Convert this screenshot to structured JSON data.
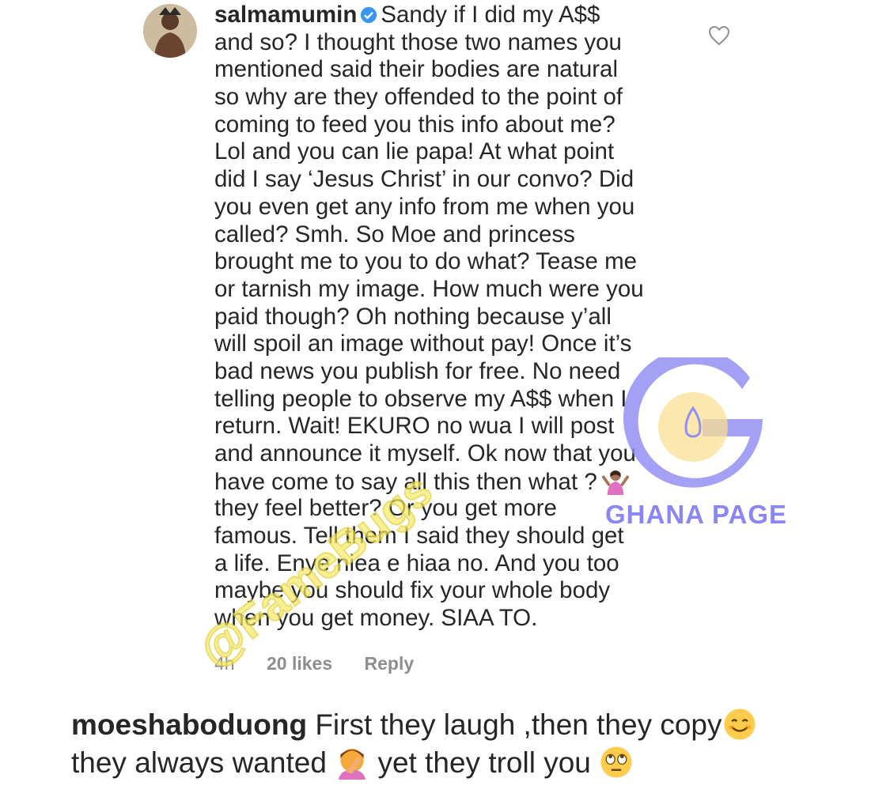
{
  "comment": {
    "username": "salmamumin",
    "verified_icon": "verified-badge-icon",
    "lines": [
      "Sandy if I did my A$$",
      "and so? I thought those two names you",
      "mentioned said their bodies are natural",
      "so why are they offended to the  point of",
      "coming to feed you this info about me?",
      "Lol and you can lie papa! At what point",
      "did I say ‘Jesus Christ’ in our convo? Did",
      "you even get any info from me when you",
      "called? Smh. So Moe and princess",
      "brought me to you to do what? Tease me",
      "or tarnish my image. How much were you",
      "paid though? Oh nothing because y’all",
      "will spoil an image without pay! Once it’s",
      "bad news you publish for free. No need",
      "telling people to observe my A$$ when I",
      "return. Wait! EKURO no wua I will post",
      "and announce it myself. Ok now that you",
      "have come to say all this then what ?",
      "they feel better? Or you get more",
      "famous. Tell them I said they should get",
      "a life. Enye niea e hiaa no. And you too",
      "maybe you should fix your whole body",
      "when you get money. SIAA TO."
    ],
    "inline_emoji": "person-shrugging-emoji",
    "time": "4h",
    "likes": "20 likes",
    "reply_label": "Reply",
    "like_icon": "heart-icon"
  },
  "reply": {
    "username": "moeshaboduong",
    "line1_text": "First they laugh ,then they copy",
    "line1_emoji": "smiling-face-emoji",
    "line2_text_a": "they always wanted",
    "line2_emoji_a": "face-palm-emoji",
    "line2_text_b": "yet they troll you",
    "line2_emoji_b": "eye-roll-emoji"
  },
  "watermarks": {
    "ghana_page": "GHANA PAGE",
    "famebugs": "@FameBugs"
  },
  "colors": {
    "text": "#262626",
    "meta": "#8e8e8e",
    "verified": "#3897f0",
    "ghana_purple": "#8a86f2",
    "ghana_yellow": "#f9de8a",
    "famebugs_yellow": "#f7ea6a"
  }
}
